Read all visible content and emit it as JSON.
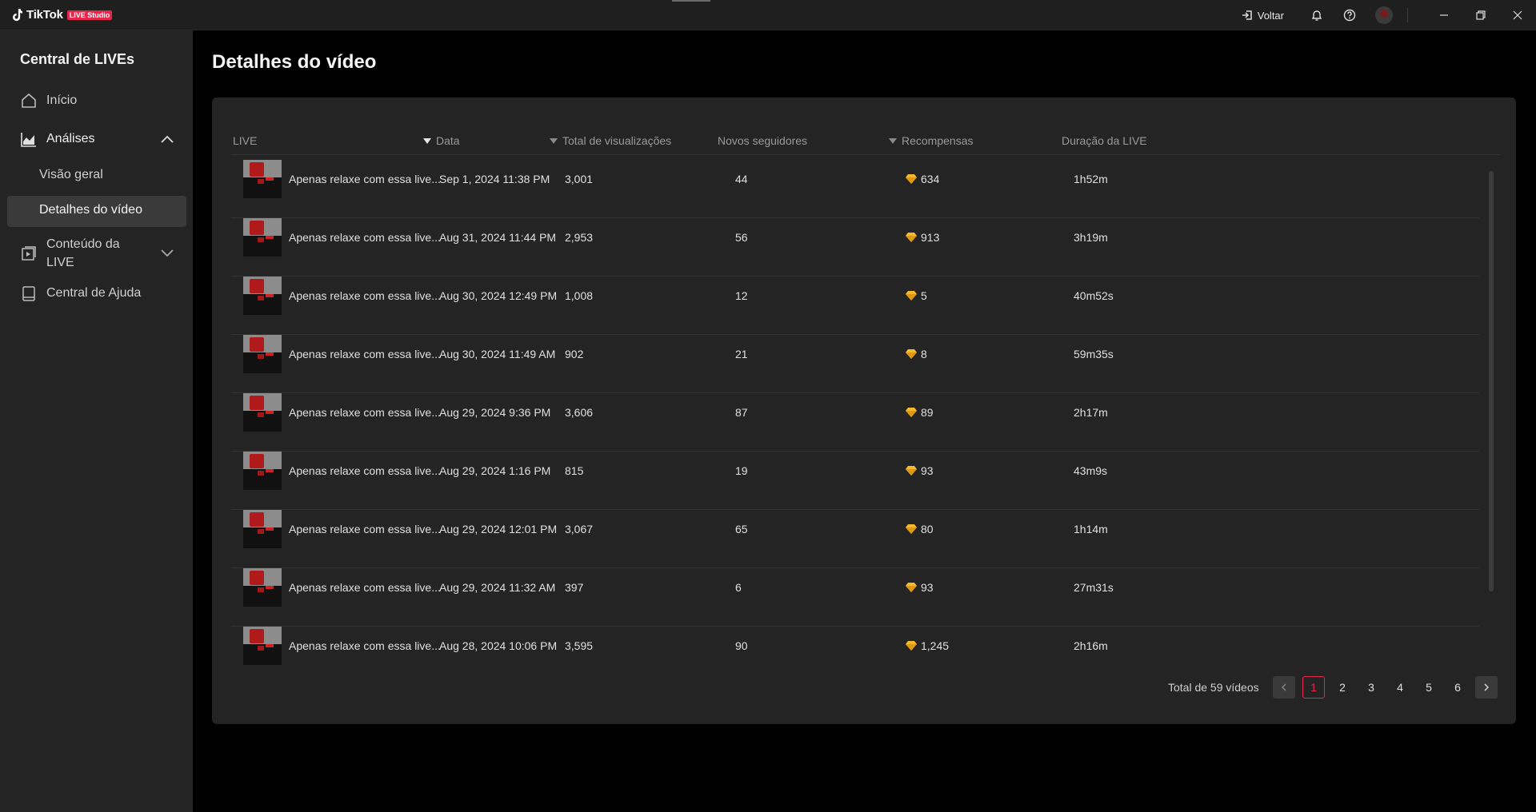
{
  "app": {
    "name": "TikTok",
    "badge": "LIVE Studio",
    "back_label": "Voltar"
  },
  "sidebar": {
    "title": "Central de LIVEs",
    "items": [
      {
        "label": "Início",
        "icon": "home-icon"
      },
      {
        "label": "Análises",
        "icon": "chart-icon",
        "expanded": true
      },
      {
        "label": "Conteúdo da LIVE",
        "icon": "video-icon",
        "expanded": false
      },
      {
        "label": "Central de Ajuda",
        "icon": "book-icon"
      }
    ],
    "subitems": [
      {
        "label": "Visão geral"
      },
      {
        "label": "Detalhes do vídeo",
        "active": true
      }
    ]
  },
  "main": {
    "title": "Detalhes do vídeo",
    "columns": [
      "LIVE",
      "Data",
      "Total de visualizações",
      "Novos seguidores",
      "Recompensas",
      "Duração da LIVE"
    ],
    "rows": [
      {
        "title": "Apenas relaxe com essa live...",
        "date": "Sep 1, 2024 11:38 PM",
        "views": "3,001",
        "followers": "44",
        "rewards": "634",
        "duration": "1h52m"
      },
      {
        "title": "Apenas relaxe com essa live...",
        "date": "Aug 31, 2024 11:44 PM",
        "views": "2,953",
        "followers": "56",
        "rewards": "913",
        "duration": "3h19m"
      },
      {
        "title": "Apenas relaxe com essa live...",
        "date": "Aug 30, 2024 12:49 PM",
        "views": "1,008",
        "followers": "12",
        "rewards": "5",
        "duration": "40m52s"
      },
      {
        "title": "Apenas relaxe com essa live...",
        "date": "Aug 30, 2024 11:49 AM",
        "views": "902",
        "followers": "21",
        "rewards": "8",
        "duration": "59m35s"
      },
      {
        "title": "Apenas relaxe com essa live...",
        "date": "Aug 29, 2024 9:36 PM",
        "views": "3,606",
        "followers": "87",
        "rewards": "89",
        "duration": "2h17m"
      },
      {
        "title": "Apenas relaxe com essa live...",
        "date": "Aug 29, 2024 1:16 PM",
        "views": "815",
        "followers": "19",
        "rewards": "93",
        "duration": "43m9s"
      },
      {
        "title": "Apenas relaxe com essa live...",
        "date": "Aug 29, 2024 12:01 PM",
        "views": "3,067",
        "followers": "65",
        "rewards": "80",
        "duration": "1h14m"
      },
      {
        "title": "Apenas relaxe com essa live...",
        "date": "Aug 29, 2024 11:32 AM",
        "views": "397",
        "followers": "6",
        "rewards": "93",
        "duration": "27m31s"
      },
      {
        "title": "Apenas relaxe com essa live...",
        "date": "Aug 28, 2024 10:06 PM",
        "views": "3,595",
        "followers": "90",
        "rewards": "1,245",
        "duration": "2h16m"
      }
    ],
    "pagination": {
      "total_label": "Total de 59 vídeos",
      "pages": [
        "1",
        "2",
        "3",
        "4",
        "5",
        "6"
      ],
      "current": "1"
    }
  },
  "colors": {
    "accent": "#e8254a",
    "background": "#000000",
    "panel": "#242424",
    "gem": "#f5b82e"
  }
}
